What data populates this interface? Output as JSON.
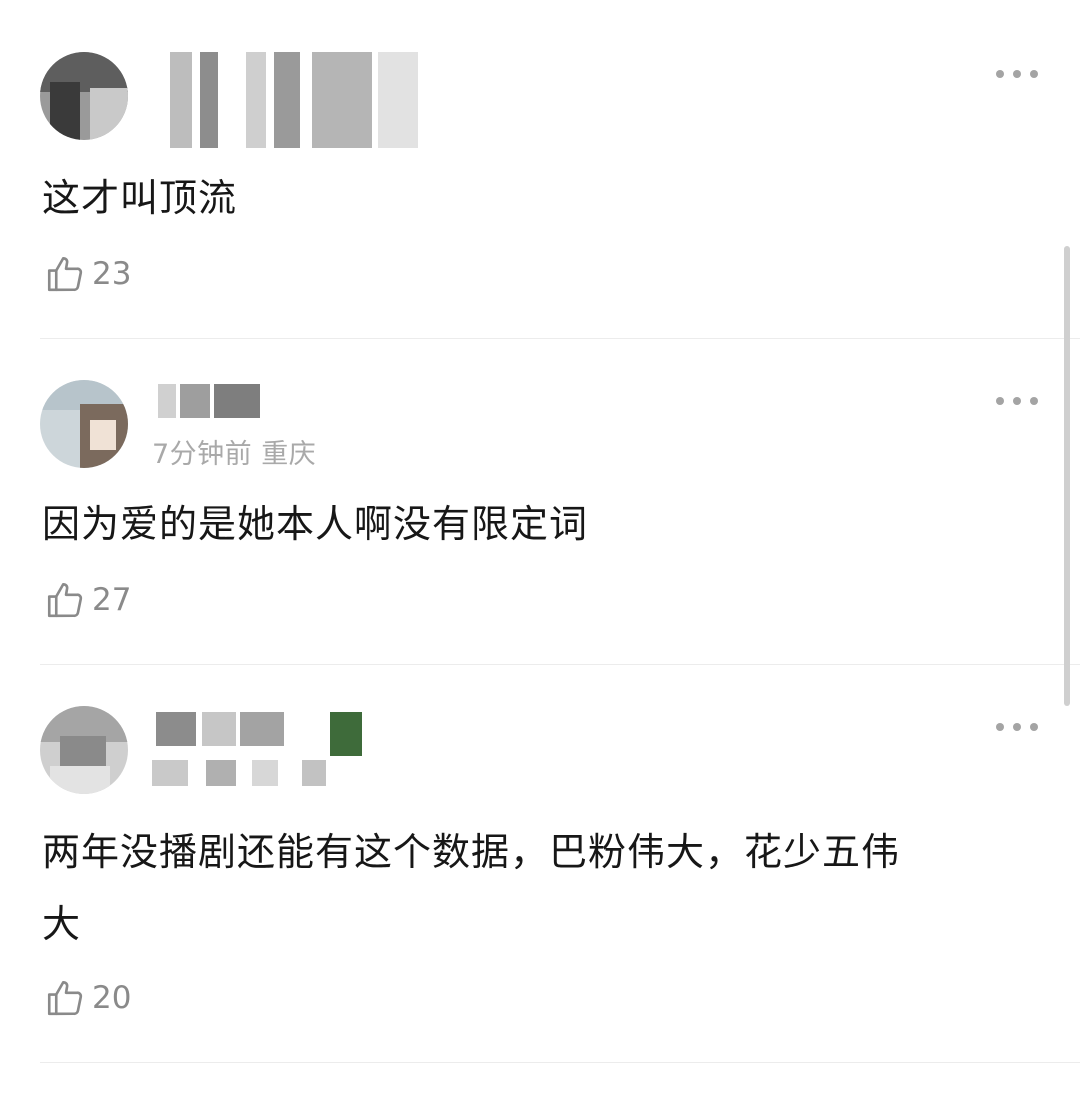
{
  "comments": [
    {
      "meta": "",
      "text": "这才叫顶流",
      "likes": "23"
    },
    {
      "meta": "7分钟前 重庆",
      "text": "因为爱的是她本人啊没有限定词",
      "likes": "27"
    },
    {
      "meta": "",
      "text_line1": "两年没播剧还能有这个数据，巴粉伟大，花少五伟",
      "text_line2": "大",
      "likes": "20"
    }
  ],
  "icons": {
    "like": "thumbs-up-icon",
    "more": "more-dots-icon"
  },
  "colors": {
    "meta": "#a9a9a9",
    "text": "#171717",
    "divider": "#ececec"
  }
}
